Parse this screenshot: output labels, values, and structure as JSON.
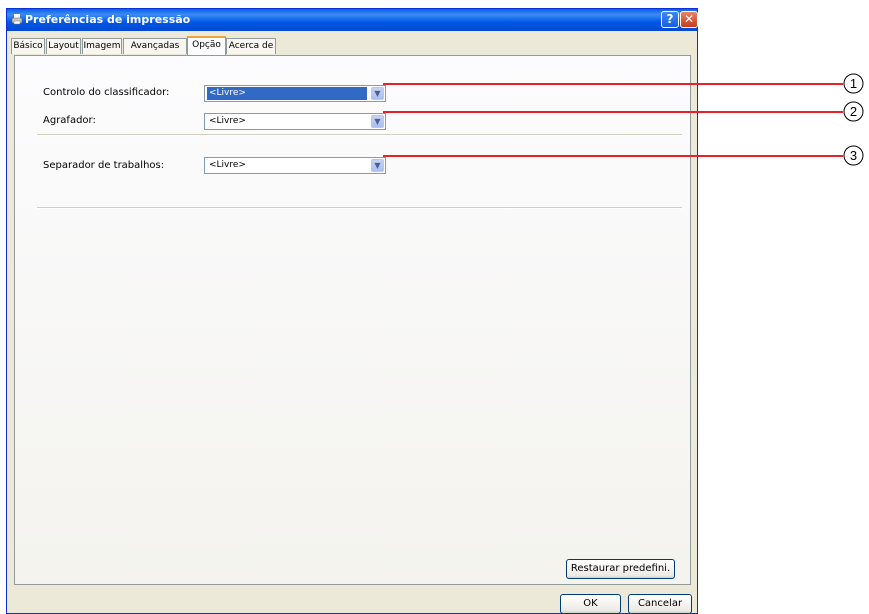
{
  "window": {
    "title": "Preferências de impressão",
    "help_button": "?",
    "close_button": "✕"
  },
  "tabs": [
    {
      "label": "Básico",
      "active": false
    },
    {
      "label": "Layout",
      "active": false
    },
    {
      "label": "Imagem",
      "active": false
    },
    {
      "label": "Avançadas",
      "active": false
    },
    {
      "label": "Opção",
      "active": true
    },
    {
      "label": "Acerca de",
      "active": false
    }
  ],
  "options": {
    "sorter_label": "Controlo do classificador:",
    "sorter_value": "<Livre>",
    "stapler_label": "Agrafador:",
    "stapler_value": "<Livre>",
    "job_separator_label": "Separador de trabalhos:",
    "job_separator_value": "<Livre>"
  },
  "buttons": {
    "restore": "Restaurar predefini.",
    "ok": "OK",
    "cancel": "Cancelar"
  },
  "callouts": [
    "1",
    "2",
    "3"
  ],
  "colors": {
    "callout_line": "#e8202a",
    "selection": "#316ac5",
    "title_bar": "#0058e6"
  }
}
